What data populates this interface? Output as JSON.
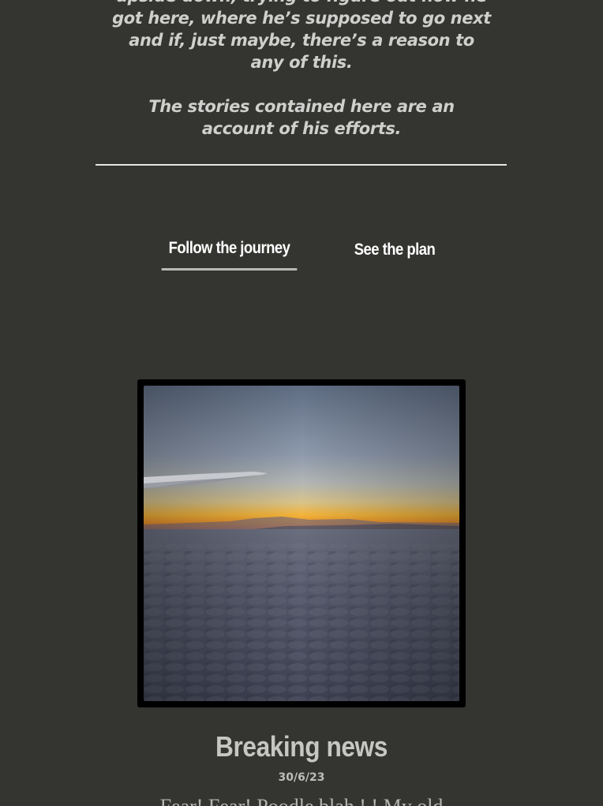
{
  "intro": {
    "lines": [
      "upside down, trying to figure out how he",
      "got here, where he’s supposed to go next",
      "and if, just maybe, there’s a reason to",
      "any of this."
    ],
    "closing_lines": [
      "The stories contained here are an",
      "account of his efforts."
    ]
  },
  "tabs": {
    "follow_label": "Follow the journey",
    "plan_label": "See the plan",
    "active": "Follow the journey"
  },
  "post": {
    "title": "Breaking news",
    "date": "30/6/23",
    "excerpt": "Fear! Fear! Poodle blah  ! ! My old"
  },
  "colors": {
    "background": "#343431",
    "text_light": "#cfcfcd",
    "tab_underline": "#b9b9b6"
  }
}
